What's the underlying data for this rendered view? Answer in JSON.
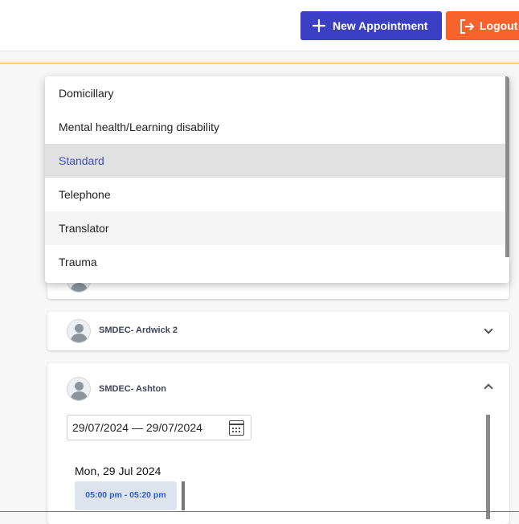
{
  "toolbar": {
    "new_appointment_label": "New Appointment",
    "logout_label": "Logout"
  },
  "dropdown": {
    "options": [
      {
        "label": "Domicillary",
        "state": "normal"
      },
      {
        "label": "Mental health/Learning disability",
        "state": "normal"
      },
      {
        "label": "Standard",
        "state": "selected"
      },
      {
        "label": "Telephone",
        "state": "normal"
      },
      {
        "label": "Translator",
        "state": "hovered"
      },
      {
        "label": "Trauma",
        "state": "normal"
      }
    ]
  },
  "locations": [
    {
      "name": "",
      "expanded": false
    },
    {
      "name": "SMDEC- Ardwick 2",
      "expanded": false
    },
    {
      "name": "SMDEC- Ashton",
      "expanded": true
    }
  ],
  "ashton": {
    "date_range": "29/07/2024 — 29/07/2024",
    "day_label": "Mon, 29 Jul 2024",
    "slot": "05:00 pm - 05:20 pm"
  },
  "colors": {
    "primary": "#3a3fc4",
    "logout": "#f7632a",
    "selected_text": "#3f51b5",
    "slot_text": "#2f5bd5"
  },
  "icons": {
    "new_appointment": "plus-icon",
    "logout": "logout-icon",
    "avatar": "user-icon",
    "calendar": "calendar-icon"
  }
}
